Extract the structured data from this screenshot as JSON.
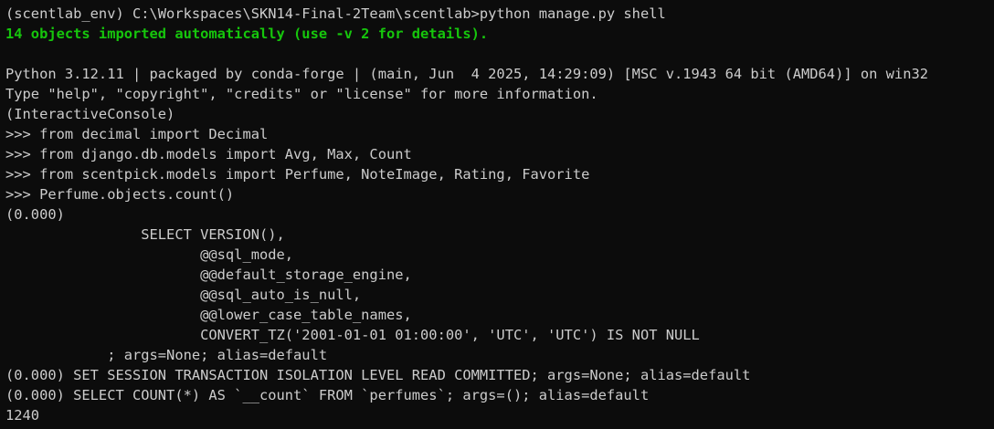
{
  "terminal": {
    "lines": [
      {
        "text": "(scentlab_env) C:\\Workspaces\\SKN14-Final-2Team\\scentlab>python manage.py shell",
        "style": "normal"
      },
      {
        "text": "14 objects imported automatically (use -v 2 for details).",
        "style": "green"
      },
      {
        "text": "",
        "style": "normal"
      },
      {
        "text": "Python 3.12.11 | packaged by conda-forge | (main, Jun  4 2025, 14:29:09) [MSC v.1943 64 bit (AMD64)] on win32",
        "style": "normal"
      },
      {
        "text": "Type \"help\", \"copyright\", \"credits\" or \"license\" for more information.",
        "style": "normal"
      },
      {
        "text": "(InteractiveConsole)",
        "style": "normal"
      },
      {
        "text": ">>> from decimal import Decimal",
        "style": "normal"
      },
      {
        "text": ">>> from django.db.models import Avg, Max, Count",
        "style": "normal"
      },
      {
        "text": ">>> from scentpick.models import Perfume, NoteImage, Rating, Favorite",
        "style": "normal"
      },
      {
        "text": ">>> Perfume.objects.count()",
        "style": "normal"
      },
      {
        "text": "(0.000)",
        "style": "normal"
      },
      {
        "text": "                SELECT VERSION(),",
        "style": "normal"
      },
      {
        "text": "                       @@sql_mode,",
        "style": "normal"
      },
      {
        "text": "                       @@default_storage_engine,",
        "style": "normal"
      },
      {
        "text": "                       @@sql_auto_is_null,",
        "style": "normal"
      },
      {
        "text": "                       @@lower_case_table_names,",
        "style": "normal"
      },
      {
        "text": "                       CONVERT_TZ('2001-01-01 01:00:00', 'UTC', 'UTC') IS NOT NULL",
        "style": "normal"
      },
      {
        "text": "            ; args=None; alias=default",
        "style": "normal"
      },
      {
        "text": "(0.000) SET SESSION TRANSACTION ISOLATION LEVEL READ COMMITTED; args=None; alias=default",
        "style": "normal"
      },
      {
        "text": "(0.000) SELECT COUNT(*) AS `__count` FROM `perfumes`; args=(); alias=default",
        "style": "normal"
      },
      {
        "text": "1240",
        "style": "normal"
      }
    ]
  },
  "colors": {
    "background": "#0c0c0c",
    "foreground": "#cccccc",
    "success": "#16c60c"
  }
}
